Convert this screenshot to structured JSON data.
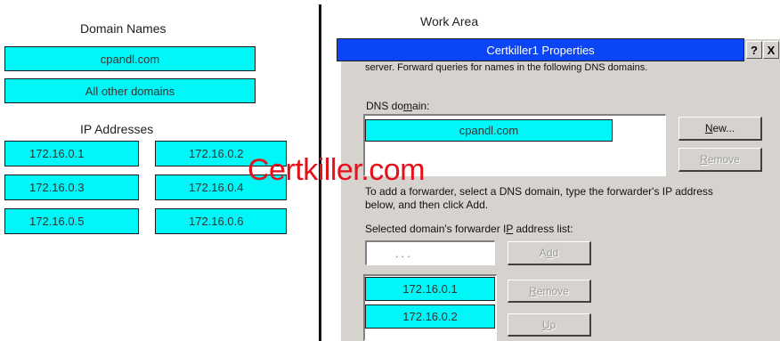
{
  "left_panel": {
    "domain_names_header": "Domain Names",
    "domains": [
      "cpandl.com",
      "All other domains"
    ],
    "ip_header": "IP Addresses",
    "ips": [
      "172.16.0.1",
      "172.16.0.2",
      "172.16.0.3",
      "172.16.0.4",
      "172.16.0.5",
      "172.16.0.6"
    ]
  },
  "work_area": {
    "header": "Work Area"
  },
  "dialog": {
    "title": "Certkiller1 Properties",
    "help_btn": "?",
    "close_btn": "X",
    "top_text": "server. Forward queries for names in the following DNS domains.",
    "dns_domain_label": "DNS domain:",
    "dns_domain_item": "cpandl.com",
    "new_btn": "New...",
    "remove_btn_top": "Remove",
    "instructions": "To add a forwarder, select a DNS domain, type the forwarder's IP address below, and then click Add.",
    "instructions_line1": "To add a forwarder, select a DNS domain, type the forwarder's IP address",
    "instructions_line2": "below, and then click Add.",
    "forwarder_label": "Selected domain's forwarder IP address list:",
    "ip_input_placeholder": ".    .    .",
    "add_btn": "Add",
    "forwarder_ips": [
      "172.16.0.1",
      "172.16.0.2"
    ],
    "remove_btn_bottom": "Remove",
    "up_btn": "Up"
  },
  "watermark": "Certkiller.com",
  "colors": {
    "cyan": "#00f7f7",
    "titlebar": "#0a46f5",
    "watermark": "#e4101a",
    "dialog_bg": "#d6d3ce"
  }
}
